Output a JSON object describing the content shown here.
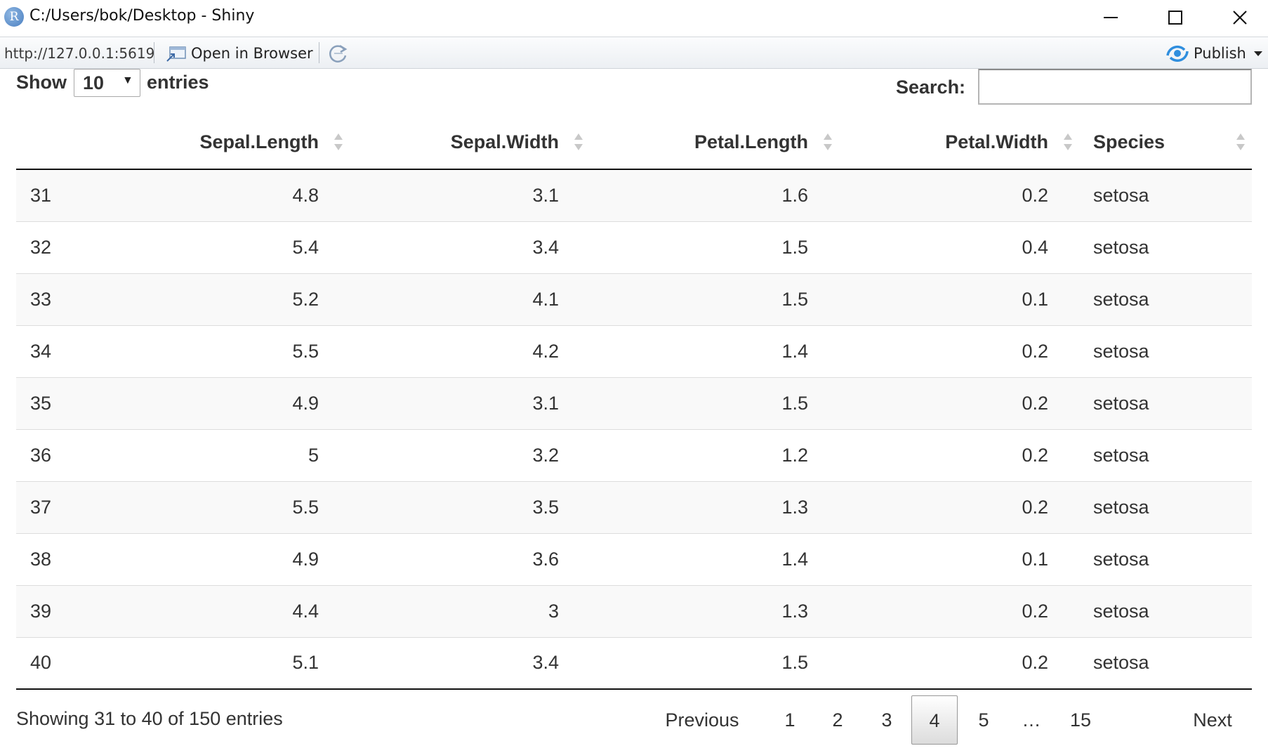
{
  "window": {
    "app_icon_letter": "R",
    "title": "C:/Users/bok/Desktop - Shiny"
  },
  "toolbar": {
    "url": "http://127.0.0.1:5619",
    "open_in_browser": "Open in Browser",
    "publish": "Publish",
    "publish_icon": "publish-icon",
    "refresh_icon": "refresh-icon"
  },
  "length": {
    "label_before": "Show",
    "value": "10",
    "label_after": "entries"
  },
  "search": {
    "label": "Search:",
    "value": ""
  },
  "table": {
    "columns": [
      "",
      "Sepal.Length",
      "Sepal.Width",
      "Petal.Length",
      "Petal.Width",
      "Species"
    ],
    "rows": [
      [
        "31",
        "4.8",
        "3.1",
        "1.6",
        "0.2",
        "setosa"
      ],
      [
        "32",
        "5.4",
        "3.4",
        "1.5",
        "0.4",
        "setosa"
      ],
      [
        "33",
        "5.2",
        "4.1",
        "1.5",
        "0.1",
        "setosa"
      ],
      [
        "34",
        "5.5",
        "4.2",
        "1.4",
        "0.2",
        "setosa"
      ],
      [
        "35",
        "4.9",
        "3.1",
        "1.5",
        "0.2",
        "setosa"
      ],
      [
        "36",
        "5",
        "3.2",
        "1.2",
        "0.2",
        "setosa"
      ],
      [
        "37",
        "5.5",
        "3.5",
        "1.3",
        "0.2",
        "setosa"
      ],
      [
        "38",
        "4.9",
        "3.6",
        "1.4",
        "0.1",
        "setosa"
      ],
      [
        "39",
        "4.4",
        "3",
        "1.3",
        "0.2",
        "setosa"
      ],
      [
        "40",
        "5.1",
        "3.4",
        "1.5",
        "0.2",
        "setosa"
      ]
    ]
  },
  "info": "Showing 31 to 40 of 150 entries",
  "pagination": {
    "previous": "Previous",
    "pages": [
      "1",
      "2",
      "3",
      "4",
      "5",
      "…",
      "15"
    ],
    "current": "4",
    "next": "Next"
  }
}
